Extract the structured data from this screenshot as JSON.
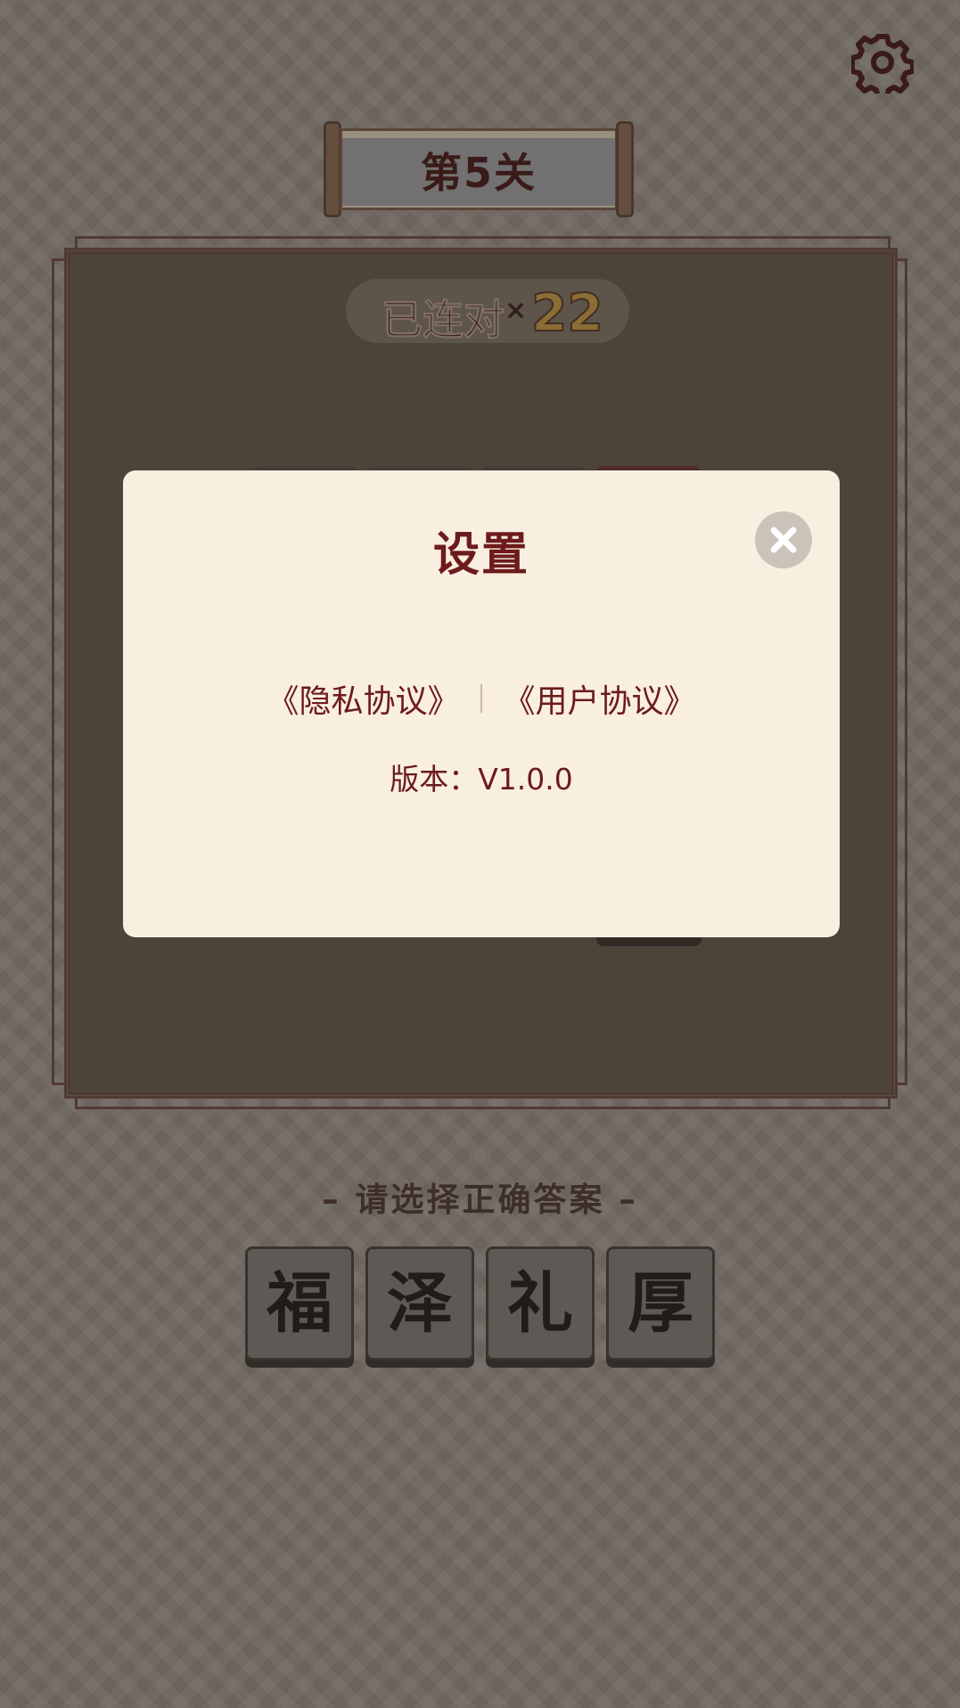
{
  "level": {
    "label": "第5关"
  },
  "combo": {
    "label": "已连对",
    "multiplier": "×",
    "count": "22"
  },
  "modal": {
    "title": "设置",
    "privacy_link": "《隐私协议》",
    "user_link": "《用户协议》",
    "version": "版本：V1.0.0"
  },
  "answers": {
    "prompt": "– 请选择正确答案 –",
    "options": [
      "福",
      "泽",
      "礼",
      "厚"
    ]
  },
  "icons": {
    "settings": "gear-icon",
    "close": "close-icon"
  },
  "colors": {
    "modal_bg": "#f8efe1",
    "accent_text": "#6d1b1b",
    "combo_gold": "#b08a3a"
  }
}
